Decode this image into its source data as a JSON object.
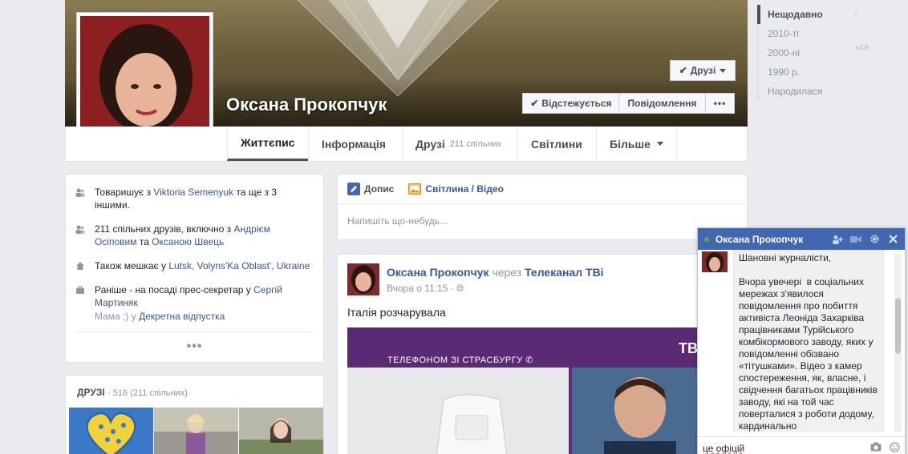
{
  "profile": {
    "name": "Оксана Прокопчук",
    "buttons": {
      "friends": "Друзі",
      "following": "Відстежується",
      "message": "Повідомлення",
      "more": "•••"
    }
  },
  "nav": {
    "tabs": [
      {
        "label": "Життєпис"
      },
      {
        "label": "Інформація"
      },
      {
        "label": "Друзі",
        "sub": "211 спільних"
      },
      {
        "label": "Світлини"
      },
      {
        "label": "Більше"
      }
    ]
  },
  "timeline": {
    "items": [
      "Нещодавно",
      "2010-ті",
      "2000-ні",
      "1990 р.",
      "Народилася"
    ]
  },
  "intro": {
    "row1": {
      "pre": "Товаришує з ",
      "link": "Viktoria Semenyuk",
      "post": " та ще з 3 іншими."
    },
    "row2": {
      "pre": "211 спільних друзів, включно з ",
      "link1": "Андрієм Осіповим",
      "mid": " та ",
      "link2": "Оксаною Швець"
    },
    "row3": {
      "pre": "Також мешкає у ",
      "link": "Lutsk, Volyns'Ka Oblast', Ukraine"
    },
    "row4": {
      "pre": "Раніше - на посаді прес-секретар у ",
      "link": "Сергій Мартиняк"
    },
    "row5": {
      "pre": "Мама ;) у ",
      "link": "Декретна відпустка"
    },
    "more": "•••"
  },
  "friends": {
    "title": "ДРУЗІ",
    "count": "· 516 (211 спільних)"
  },
  "composer": {
    "tab_post": "Допис",
    "tab_photo": "Світлина / Відео",
    "placeholder": "Напишіть що-небудь..."
  },
  "post": {
    "author": "Оксана Прокопчук",
    "via": " через ",
    "page": "Телеканал ТВі",
    "time": "Вчора о 11:15 ·",
    "text": "Італія розчарувала",
    "media_caption": "ТЕЛЕФОНОМ ЗІ СТРАСБУРГУ",
    "media_logo": "ТВі"
  },
  "chat": {
    "title": "Оксана Прокопчук",
    "message": "Шановні журналісти,\n\nВчора увечері  в соціальних мережах з'явилося повідомлення про побиття активіста Леоніда Захарківа працівниками Турійського комбікормового заводу, яких у повідомленні обізвано «тітушками». Відео з камер спостереження, як, власне, і свідчення багатьох працівників заводу, які на той час поверталися з роботи додому, кардинально",
    "input_value": "це офіцій"
  },
  "ghost_text": {
    "a": "›",
    "b": "ься"
  }
}
